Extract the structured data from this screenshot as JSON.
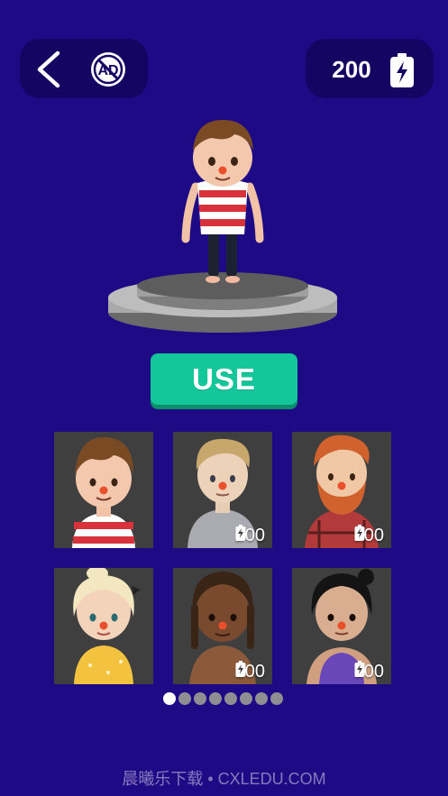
{
  "header": {
    "back_icon": "chevron-left-icon",
    "no_ads_icon": "no-ads-icon",
    "no_ads_text": "AD",
    "energy_balance": "200",
    "energy_icon": "battery-bolt-icon"
  },
  "preview": {
    "selected_character": "boy-striped-shirt"
  },
  "use_button": {
    "label": "USE"
  },
  "characters": [
    {
      "id": "boy-striped-shirt",
      "price": ""
    },
    {
      "id": "blond-man-gray-shirt",
      "price": "200"
    },
    {
      "id": "bearded-man-plaid-shirt",
      "price": "200"
    },
    {
      "id": "blonde-girl-yellow-dress",
      "price": "200"
    },
    {
      "id": "woman-dreadlocks",
      "price": "200"
    },
    {
      "id": "woman-purple-top",
      "price": "200"
    }
  ],
  "pagination": {
    "pages": 8,
    "current": 1
  },
  "watermark": "晨曦乐下载 • CXLEDU.COM",
  "colors": {
    "background": "#1f0a86",
    "panel": "#150562",
    "use_button": "#14c79a",
    "card": "#3f3f3f"
  }
}
